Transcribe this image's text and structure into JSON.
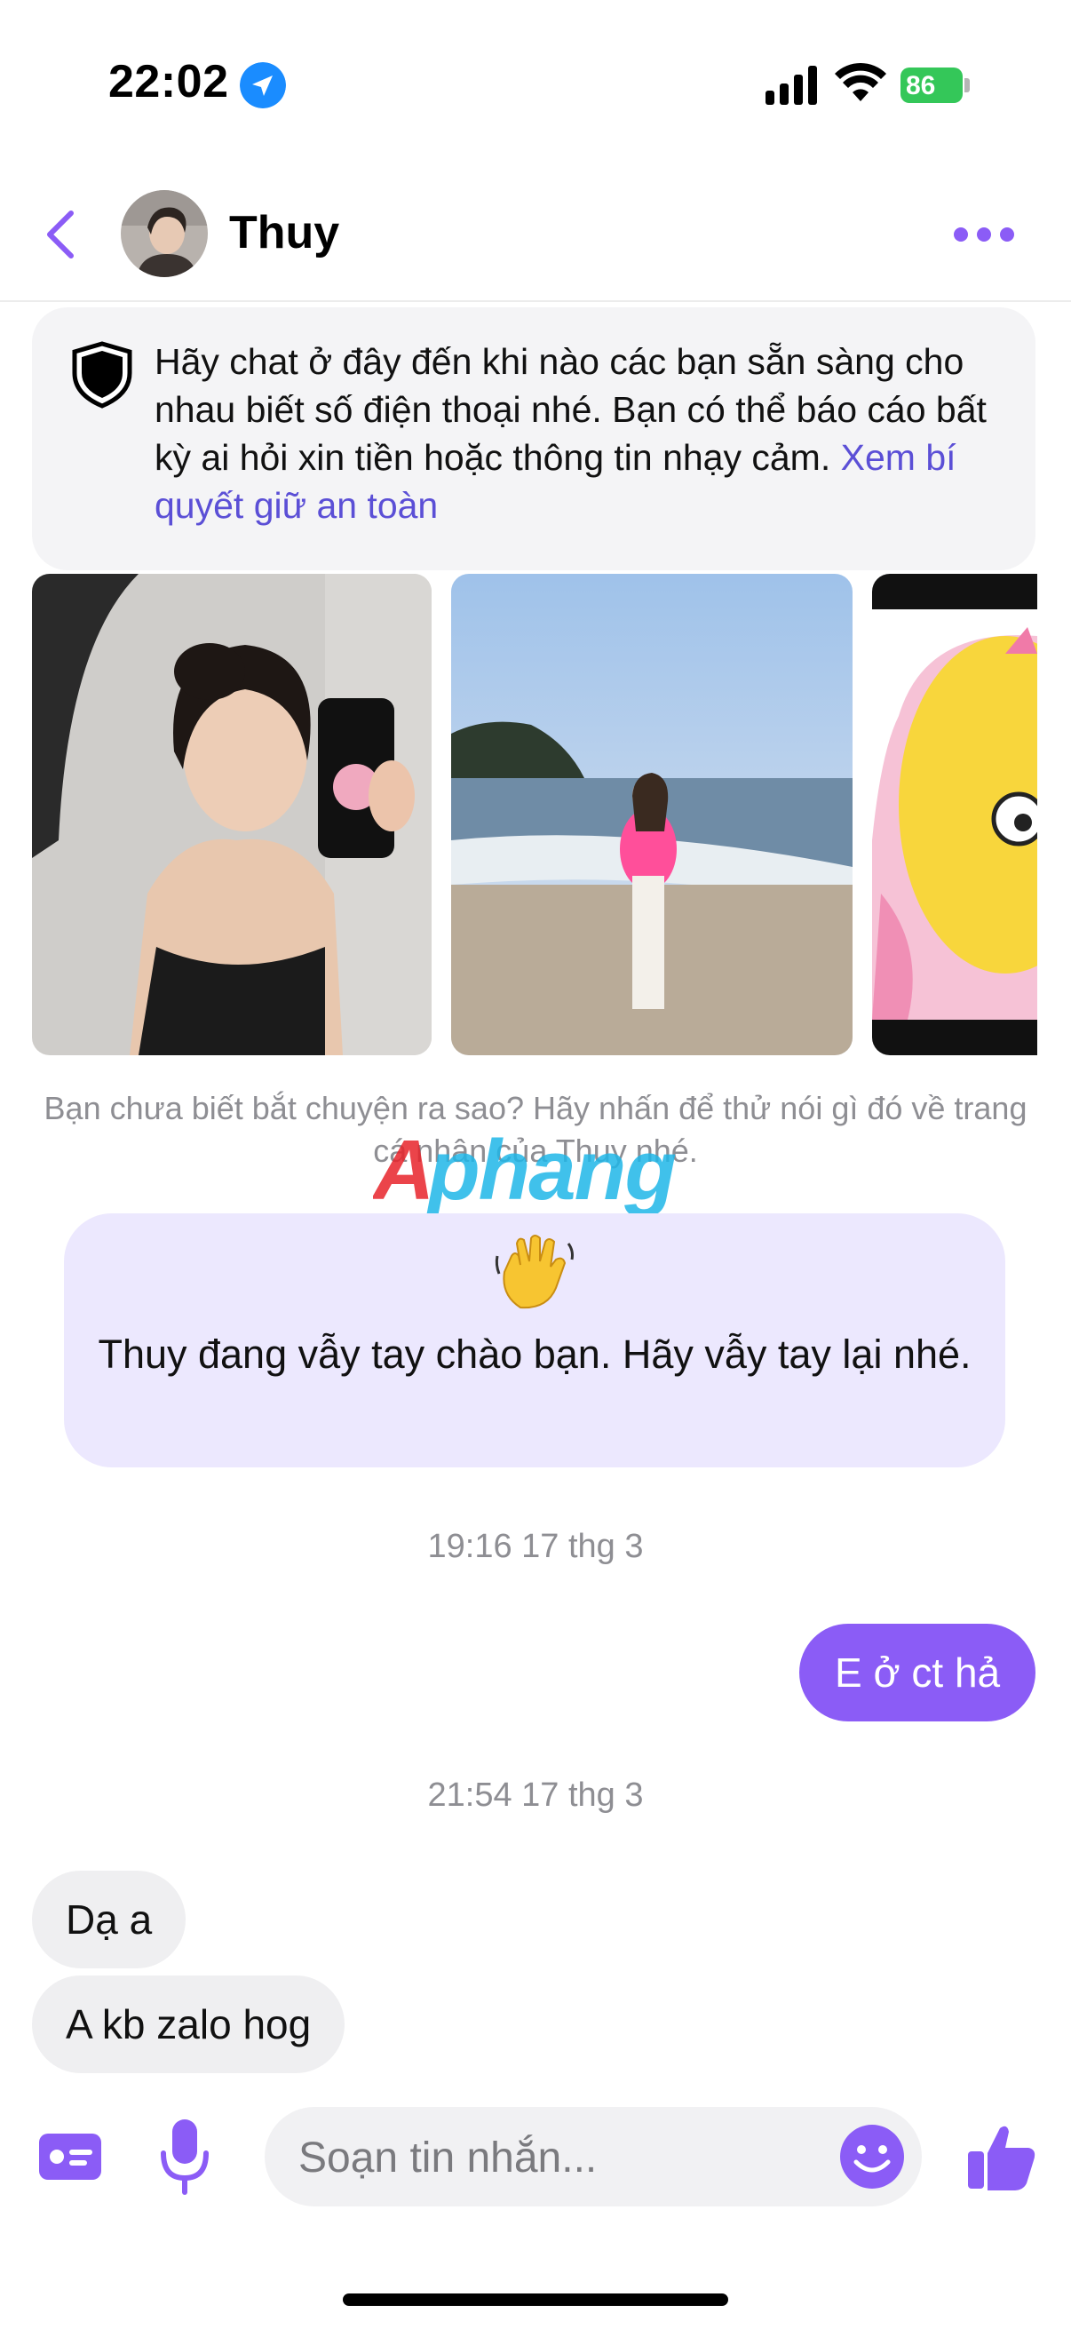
{
  "status_bar": {
    "time": "22:02",
    "battery": "86",
    "icons": [
      "location-arrow-icon",
      "signal-icon",
      "wifi-icon",
      "battery-charging-icon"
    ]
  },
  "header": {
    "contact_name": "Thuy",
    "back_icon": "chevron-left-icon",
    "more_icon": "more-horizontal-icon",
    "accent": "#8b5cf6"
  },
  "safety_notice": {
    "text": "Hãy chat ở đây đến khi nào các bạn sẵn sàng cho nhau biết số điện thoại nhé. Bạn có thể báo cáo bất kỳ ai hỏi xin tiền hoặc thông tin nhạy cảm.",
    "link": "Xem bí quyết giữ an toàn",
    "link_color": "#5b4fd6"
  },
  "profile_photos": [
    "photo-mirror-selfie",
    "photo-beach",
    "photo-cartoon-sticker"
  ],
  "icebreaker_hint": "Bạn chưa biết bắt chuyện ra sao? Hãy nhấn để thử nói gì đó về trang cá nhân của Thuy nhé.",
  "watermark": "Aphang",
  "wave_card": {
    "emoji": "👋",
    "text": "Thuy đang vẫy tay chào bạn. Hãy vẫy tay lại nhé."
  },
  "messages": [
    {
      "type": "timestamp",
      "text": "19:16 17 thg 3"
    },
    {
      "type": "outgoing",
      "text": "E ở ct hả"
    },
    {
      "type": "timestamp",
      "text": "21:54 17 thg 3"
    },
    {
      "type": "incoming",
      "text": "Dạ a"
    },
    {
      "type": "incoming",
      "text": "A kb zalo hog"
    }
  ],
  "composer": {
    "placeholder": "Soạn tin nhắn...",
    "icons": [
      "contact-card-icon",
      "microphone-icon",
      "emoji-icon",
      "thumbs-up-icon"
    ]
  }
}
